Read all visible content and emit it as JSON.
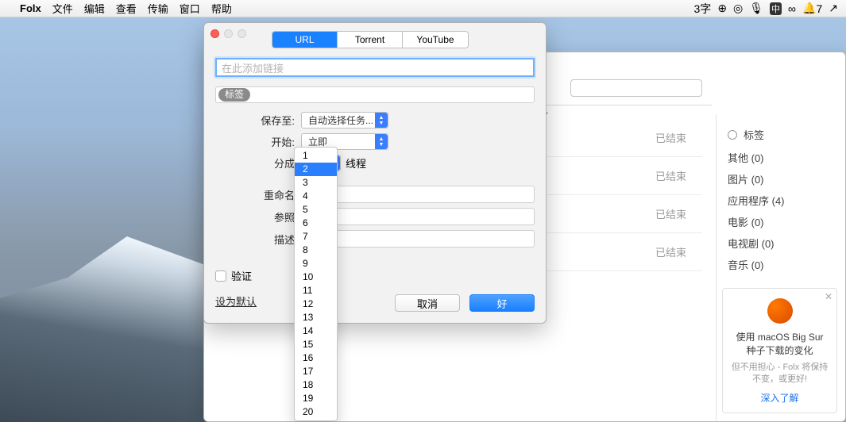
{
  "menubar": {
    "app": "Folx",
    "items": [
      "文件",
      "编辑",
      "查看",
      "传输",
      "窗口",
      "帮助"
    ],
    "right_prefix": "3字",
    "bell_count": "7"
  },
  "back_window": {
    "status": "已结束"
  },
  "sidebar": {
    "header": "标签",
    "items": [
      "其他 (0)",
      "图片 (0)",
      "应用程序 (4)",
      "电影 (0)",
      "电视剧 (0)",
      "音乐 (0)"
    ]
  },
  "promo": {
    "title1": "使用 macOS Big Sur",
    "title2": "种子下载的变化",
    "sub": "但不用担心 - Folx 将保持不变，或更好!",
    "link": "深入了解"
  },
  "dialog": {
    "tabs": {
      "url": "URL",
      "torrent": "Torrent",
      "youtube": "YouTube"
    },
    "url_placeholder": "在此添加链接",
    "tag_chip": "标签",
    "labels": {
      "save_to": "保存至:",
      "start": "开始:",
      "split": "分成",
      "threads": "线程",
      "rename": "重命名",
      "refer": "参照",
      "desc": "描述"
    },
    "save_to_value": "自动选择任务...",
    "start_value": "立即",
    "split_value": "2",
    "verify": "验证",
    "defaults": "设为默认",
    "cancel": "取消",
    "ok": "好"
  },
  "dropdown": {
    "options": [
      "1",
      "2",
      "3",
      "4",
      "5",
      "6",
      "7",
      "8",
      "9",
      "10",
      "11",
      "12",
      "13",
      "14",
      "15",
      "16",
      "17",
      "18",
      "19",
      "20"
    ],
    "selected": "2"
  }
}
